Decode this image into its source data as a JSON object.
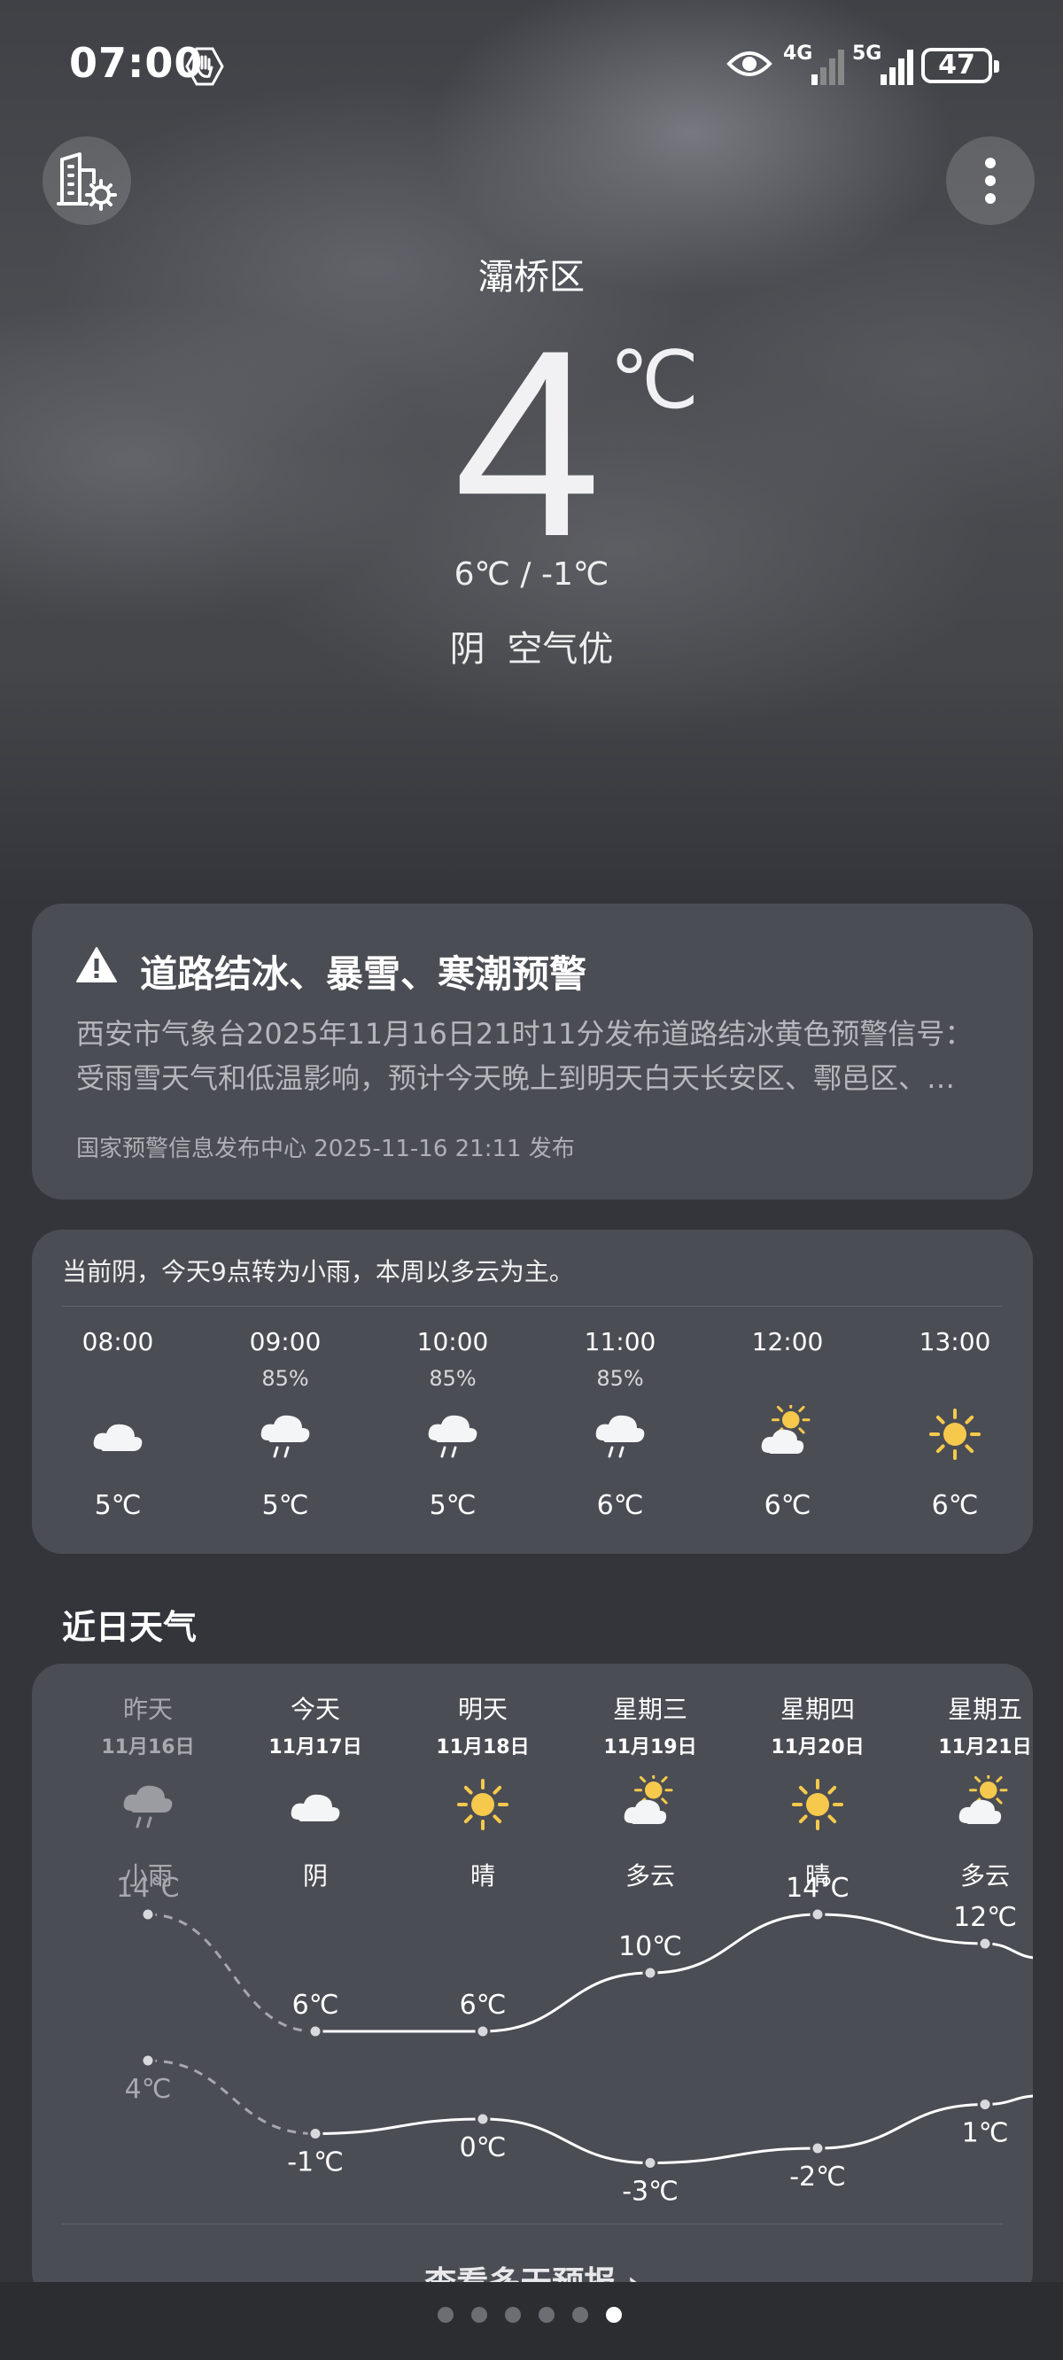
{
  "status_bar": {
    "time": "07:00",
    "signal_1": "4G",
    "signal_2": "5G",
    "battery": "47"
  },
  "icons": {
    "gesture": "hand-icon",
    "eye": "eye-icon",
    "city_manage": "city-settings-icon",
    "more": "more-vertical-icon",
    "warning": "warning-triangle-icon"
  },
  "current": {
    "location": "灞桥区",
    "temperature": "4",
    "unit": "℃",
    "range": "6℃ / -1℃",
    "condition": "阴",
    "air_quality": "空气优"
  },
  "alert": {
    "title": "道路结冰、暴雪、寒潮预警",
    "body_line1": "西安市气象台2025年11月16日21时11分发布道路结冰黄色预警信号：",
    "body_line2": "受雨雪天气和低温影响，预计今天晚上到明天白天长安区、鄠邑区、…",
    "source": "国家预警信息发布中心 2025-11-16 21:11 发布"
  },
  "hourly": {
    "summary": "当前阴，今天9点转为小雨，本周以多云为主。",
    "hours": [
      {
        "time": "08:00",
        "precip": "",
        "icon": "cloudy-icon",
        "temp": "5℃"
      },
      {
        "time": "09:00",
        "precip": "85%",
        "icon": "rain-icon",
        "temp": "5℃"
      },
      {
        "time": "10:00",
        "precip": "85%",
        "icon": "rain-icon",
        "temp": "5℃"
      },
      {
        "time": "11:00",
        "precip": "85%",
        "icon": "rain-icon",
        "temp": "6℃"
      },
      {
        "time": "12:00",
        "precip": "",
        "icon": "partly-cloudy-icon",
        "temp": "6℃"
      },
      {
        "time": "13:00",
        "precip": "",
        "icon": "sunny-icon",
        "temp": "6℃"
      }
    ]
  },
  "daily": {
    "section_title": "近日天气",
    "more_label": "查看多天预报",
    "days": [
      {
        "name": "昨天",
        "date": "11月16日",
        "icon": "rain-icon",
        "condition": "小雨",
        "high": 14,
        "low": 4,
        "high_label": "14℃",
        "low_label": "4℃"
      },
      {
        "name": "今天",
        "date": "11月17日",
        "icon": "cloudy-icon",
        "condition": "阴",
        "high": 6,
        "low": -1,
        "high_label": "6℃",
        "low_label": "-1℃"
      },
      {
        "name": "明天",
        "date": "11月18日",
        "icon": "sunny-icon",
        "condition": "晴",
        "high": 6,
        "low": 0,
        "high_label": "6℃",
        "low_label": "0℃"
      },
      {
        "name": "星期三",
        "date": "11月19日",
        "icon": "partly-cloudy-icon",
        "condition": "多云",
        "high": 10,
        "low": -3,
        "high_label": "10℃",
        "low_label": "-3℃"
      },
      {
        "name": "星期四",
        "date": "11月20日",
        "icon": "sunny-icon",
        "condition": "晴",
        "high": 14,
        "low": -2,
        "high_label": "14℃",
        "low_label": "-2℃"
      },
      {
        "name": "星期五",
        "date": "11月21日",
        "icon": "partly-cloudy-icon",
        "condition": "多云",
        "high": 12,
        "low": 1,
        "high_label": "12℃",
        "low_label": "1℃"
      }
    ]
  },
  "pager": {
    "count": 6,
    "active": 5
  }
}
